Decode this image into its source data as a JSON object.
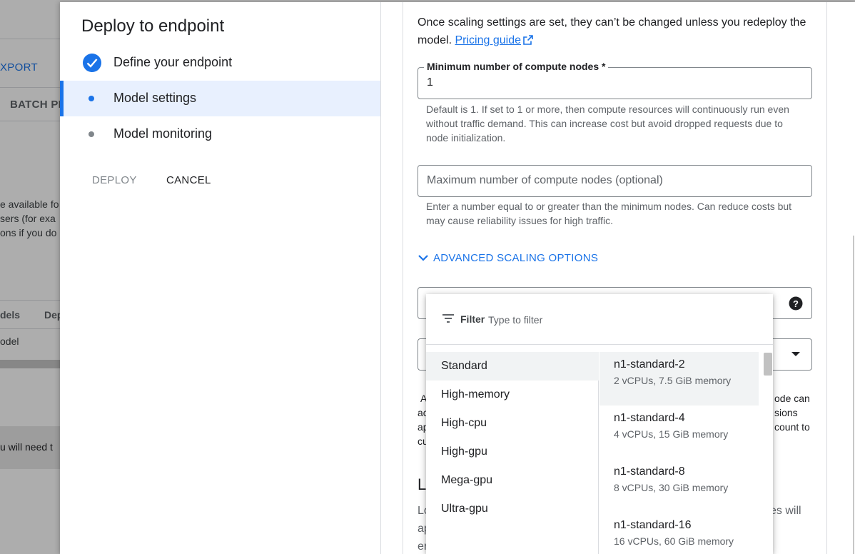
{
  "background": {
    "export_label": "XPORT",
    "batch_label": "BATCH PI",
    "text_lines": [
      "e available fo",
      "sers (for exa",
      "ons if you do"
    ],
    "table_headers": [
      "dels",
      "Dep"
    ],
    "table_row": "odel",
    "banner_text": "u will need t"
  },
  "drawer": {
    "title": "Deploy to endpoint",
    "steps": [
      {
        "label": "Define your endpoint",
        "state": "complete"
      },
      {
        "label": "Model settings",
        "state": "active"
      },
      {
        "label": "Model monitoring",
        "state": "pending"
      }
    ],
    "deploy_label": "DEPLOY",
    "cancel_label": "CANCEL"
  },
  "content": {
    "intro_text": "Once scaling settings are set, they can’t be changed unless you redeploy the model.",
    "pricing_link": "Pricing guide",
    "min_nodes": {
      "label": "Minimum number of compute nodes *",
      "value": "1",
      "helper": "Default is 1. If set to 1 or more, then compute resources will continuously run even without traffic demand. This can increase cost but avoid dropped requests due to node initialization."
    },
    "max_nodes": {
      "placeholder": "Maximum number of compute nodes (optional)",
      "helper": "Enter a number equal to or greater than the minimum nodes. Can reduce costs but may cause reliability issues for high traffic."
    },
    "advanced_label": "ADVANCED SCALING OPTIONS",
    "partial_texts": {
      "left": [
        "A",
        "ac",
        "ap",
        "cu"
      ],
      "right": [
        "ode can",
        "sions",
        "count to"
      ],
      "section_initial": "L",
      "section_left": [
        "Lo",
        "ap",
        "en"
      ],
      "section_right": "es will"
    }
  },
  "dropdown": {
    "filter_label": "Filter",
    "filter_placeholder": "Type to filter",
    "categories": [
      "Standard",
      "High-memory",
      "High-cpu",
      "High-gpu",
      "Mega-gpu",
      "Ultra-gpu"
    ],
    "selected_category": "Standard",
    "options": [
      {
        "name": "n1-standard-2",
        "desc": "2 vCPUs, 7.5 GiB memory"
      },
      {
        "name": "n1-standard-4",
        "desc": "4 vCPUs, 15 GiB memory"
      },
      {
        "name": "n1-standard-8",
        "desc": "8 vCPUs, 30 GiB memory"
      },
      {
        "name": "n1-standard-16",
        "desc": "16 vCPUs, 60 GiB memory"
      }
    ],
    "selected_option": "n1-standard-2"
  },
  "colors": {
    "accent": "#1a73e8",
    "active_step_bg": "#e8f0fe",
    "scrim": "rgba(0,0,0,0.32)"
  }
}
